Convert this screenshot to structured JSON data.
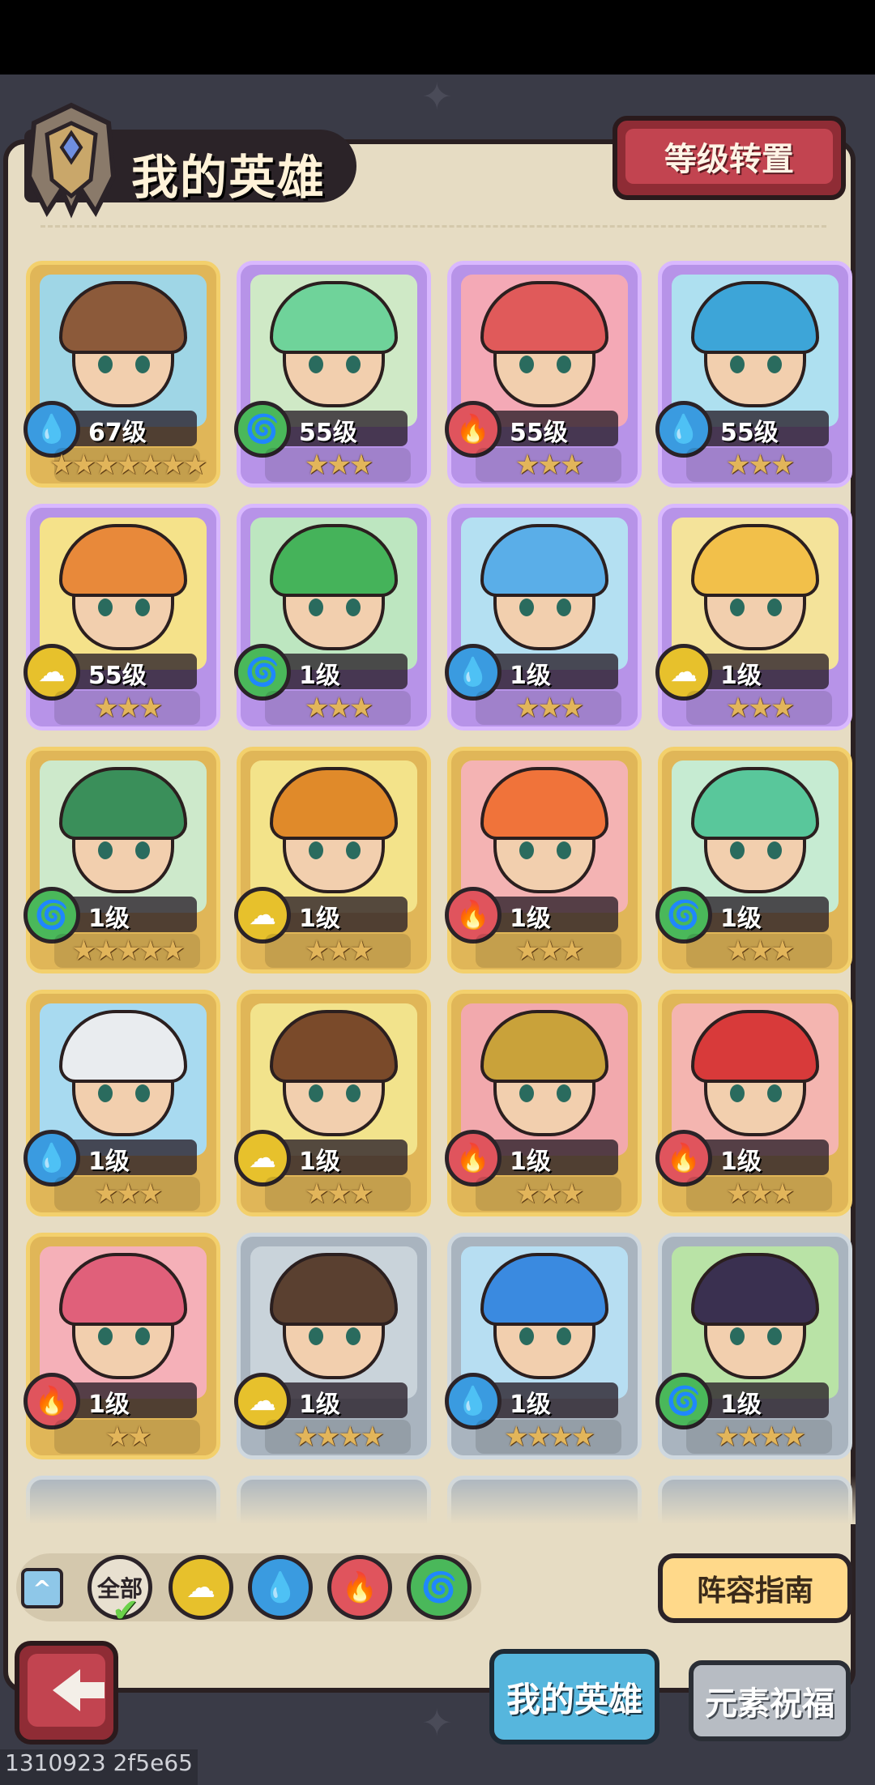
{
  "header": {
    "title": "我的英雄",
    "level_transfer_label": "等级转置"
  },
  "heroes": [
    {
      "level": "67级",
      "element": "water",
      "stars": 7,
      "frame": "gold",
      "hair": "#8c5a3a",
      "bg": "#9fd6e6"
    },
    {
      "level": "55级",
      "element": "wind",
      "stars": 3,
      "frame": "purple",
      "hair": "#6fd39a",
      "bg": "#cfe9c6"
    },
    {
      "level": "55级",
      "element": "fire",
      "stars": 3,
      "frame": "purple",
      "hair": "#e05a5a",
      "bg": "#f4a9b6"
    },
    {
      "level": "55级",
      "element": "water",
      "stars": 3,
      "frame": "purple",
      "hair": "#3da5d8",
      "bg": "#aee0f0"
    },
    {
      "level": "55级",
      "element": "earth",
      "stars": 3,
      "frame": "purple",
      "hair": "#e8893a",
      "bg": "#f5e28a"
    },
    {
      "level": "1级",
      "element": "wind",
      "stars": 3,
      "frame": "purple",
      "hair": "#45b35a",
      "bg": "#bde6c0"
    },
    {
      "level": "1级",
      "element": "water",
      "stars": 3,
      "frame": "purple",
      "hair": "#5aaee8",
      "bg": "#b4e0f2"
    },
    {
      "level": "1级",
      "element": "earth",
      "stars": 3,
      "frame": "purple",
      "hair": "#f2c04a",
      "bg": "#f4e39a"
    },
    {
      "level": "1级",
      "element": "wind",
      "stars": 5,
      "frame": "gold",
      "hair": "#3a8f5a",
      "bg": "#cde9cb"
    },
    {
      "level": "1级",
      "element": "earth",
      "stars": 3,
      "frame": "gold",
      "hair": "#e08a2a",
      "bg": "#f3e38a"
    },
    {
      "level": "1级",
      "element": "fire",
      "stars": 3,
      "frame": "gold",
      "hair": "#f0733a",
      "bg": "#f4b3b3"
    },
    {
      "level": "1级",
      "element": "wind",
      "stars": 3,
      "frame": "gold",
      "hair": "#59c79b",
      "bg": "#c6ebd2"
    },
    {
      "level": "1级",
      "element": "water",
      "stars": 3,
      "frame": "gold",
      "hair": "#e9ecef",
      "bg": "#a8daf0"
    },
    {
      "level": "1级",
      "element": "earth",
      "stars": 3,
      "frame": "gold",
      "hair": "#7a4a2a",
      "bg": "#f2e38c"
    },
    {
      "level": "1级",
      "element": "fire",
      "stars": 3,
      "frame": "gold",
      "hair": "#c9a23a",
      "bg": "#f2a9ad"
    },
    {
      "level": "1级",
      "element": "fire",
      "stars": 3,
      "frame": "gold",
      "hair": "#d83a3a",
      "bg": "#f4b5b0"
    },
    {
      "level": "1级",
      "element": "fire",
      "stars": 2,
      "frame": "gold",
      "hair": "#e0607a",
      "bg": "#f5b0b8"
    },
    {
      "level": "1级",
      "element": "earth",
      "stars": 4,
      "frame": "silver",
      "hair": "#5a4030",
      "bg": "#c9d3da"
    },
    {
      "level": "1级",
      "element": "water",
      "stars": 4,
      "frame": "silver",
      "hair": "#3a8ae0",
      "bg": "#b7def2"
    },
    {
      "level": "1级",
      "element": "wind",
      "stars": 4,
      "frame": "silver",
      "hair": "#3a3050",
      "bg": "#b9e3a6"
    }
  ],
  "element_glyphs": {
    "water": "💧",
    "wind": "🌀",
    "fire": "🔥",
    "earth": "☁"
  },
  "filters": {
    "all_label": "全部",
    "items": [
      "earth",
      "water",
      "fire",
      "wind"
    ]
  },
  "lineup_guide_label": "阵容指南",
  "tabs": {
    "my_heroes": "我的英雄",
    "element_blessing": "元素祝福"
  },
  "version": "1310923 2f5e65"
}
